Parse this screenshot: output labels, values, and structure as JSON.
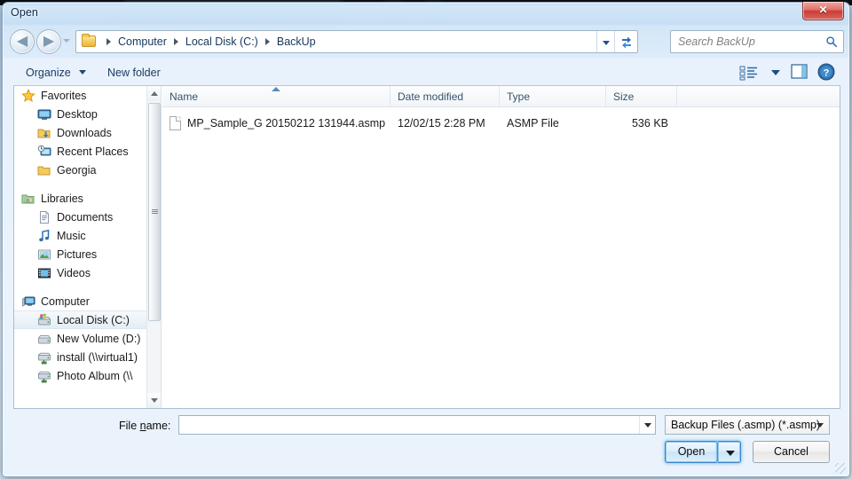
{
  "window": {
    "title": "Open",
    "close_label": "✕",
    "close_icon": "close-icon"
  },
  "navbar": {
    "back_arrow": "◀",
    "forward_arrow": "▶",
    "breadcrumbs": [
      "Computer",
      "Local Disk (C:)",
      "BackUp"
    ],
    "refresh_icon": "refresh-icon",
    "search": {
      "placeholder": "Search BackUp",
      "value": "",
      "icon": "search-icon"
    }
  },
  "commandbar": {
    "organize_label": "Organize",
    "new_folder_label": "New folder",
    "view_icon": "view-layout-icon",
    "preview_icon": "preview-pane-icon",
    "help_icon": "help-icon"
  },
  "navpane": {
    "groups": [
      {
        "header": {
          "label": "Favorites",
          "icon": "star-icon"
        },
        "items": [
          {
            "label": "Desktop",
            "icon": "desktop-icon"
          },
          {
            "label": "Downloads",
            "icon": "downloads-folder-icon"
          },
          {
            "label": "Recent Places",
            "icon": "recent-places-icon"
          },
          {
            "label": "Georgia",
            "icon": "folder-icon"
          }
        ]
      },
      {
        "header": {
          "label": "Libraries",
          "icon": "libraries-icon"
        },
        "items": [
          {
            "label": "Documents",
            "icon": "documents-icon"
          },
          {
            "label": "Music",
            "icon": "music-icon"
          },
          {
            "label": "Pictures",
            "icon": "pictures-icon"
          },
          {
            "label": "Videos",
            "icon": "videos-icon"
          }
        ]
      },
      {
        "header": {
          "label": "Computer",
          "icon": "computer-icon"
        },
        "items": [
          {
            "label": "Local Disk (C:)",
            "icon": "hard-drive-windows-icon",
            "selected": true
          },
          {
            "label": "New Volume (D:)",
            "icon": "hard-drive-icon"
          },
          {
            "label": "install (\\\\virtual1)",
            "icon": "network-drive-icon"
          },
          {
            "label": "Photo Album (\\\\",
            "icon": "network-drive-icon"
          }
        ]
      }
    ]
  },
  "filelist": {
    "columns": [
      {
        "key": "name",
        "label": "Name",
        "sorted": "asc"
      },
      {
        "key": "date",
        "label": "Date modified"
      },
      {
        "key": "type",
        "label": "Type"
      },
      {
        "key": "size",
        "label": "Size"
      }
    ],
    "rows": [
      {
        "name": "MP_Sample_G 20150212 131944.asmp",
        "date": "12/02/15 2:28 PM",
        "type": "ASMP File",
        "size": "536 KB",
        "icon": "generic-file-icon"
      }
    ]
  },
  "footer": {
    "filename_label_pre": "File ",
    "filename_label_accel": "n",
    "filename_label_post": "ame:",
    "filename_value": "",
    "filename_placeholder": "",
    "filter_value": "Backup Files (.asmp) (*.asmp)",
    "open_label": "Open",
    "cancel_label": "Cancel"
  },
  "colors": {
    "accent": "#3c85c4",
    "titlebar_text": "#0c2a47",
    "close_button": "#c93c34",
    "link_text": "#15375c",
    "window_bg": "#d6e8f8"
  }
}
